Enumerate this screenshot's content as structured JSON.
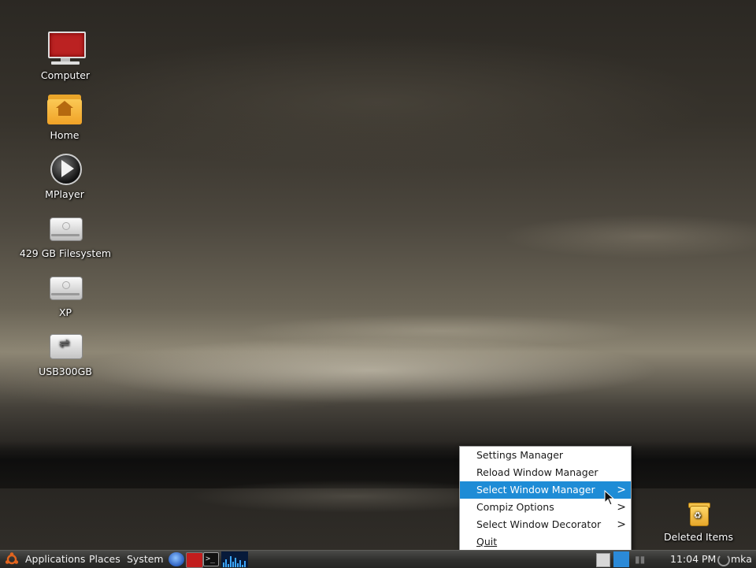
{
  "desktop": {
    "icons": [
      {
        "label": "Computer"
      },
      {
        "label": "Home"
      },
      {
        "label": "MPlayer"
      },
      {
        "label": "429 GB Filesystem"
      },
      {
        "label": "XP"
      },
      {
        "label": "USB300GB"
      }
    ],
    "trash": {
      "label": "Deleted Items"
    }
  },
  "context_menu": {
    "items": [
      {
        "label": "Settings Manager",
        "has_submenu": false
      },
      {
        "label": "Reload Window Manager",
        "has_submenu": false
      },
      {
        "label": "Select Window Manager",
        "has_submenu": true,
        "active": true
      },
      {
        "label": "Compiz Options",
        "has_submenu": true
      },
      {
        "label": "Select Window Decorator",
        "has_submenu": true
      },
      {
        "label": "Quit",
        "has_submenu": false
      }
    ],
    "submenu_arrow": ">"
  },
  "panel": {
    "menus": {
      "applications": "Applications",
      "places": "Places",
      "system": "System"
    },
    "terminal_glyph": ">_",
    "clock": "11:04 PM",
    "user": "mka"
  },
  "colors": {
    "menu_highlight": "#1e8cd6",
    "panel_bg": "#2f2f2d"
  },
  "icons": {
    "computer": "computer-icon",
    "home": "home-folder-icon",
    "mplayer": "media-player-icon",
    "filesystem": "hard-drive-icon",
    "usb": "usb-drive-icon",
    "trash": "trash-icon"
  }
}
